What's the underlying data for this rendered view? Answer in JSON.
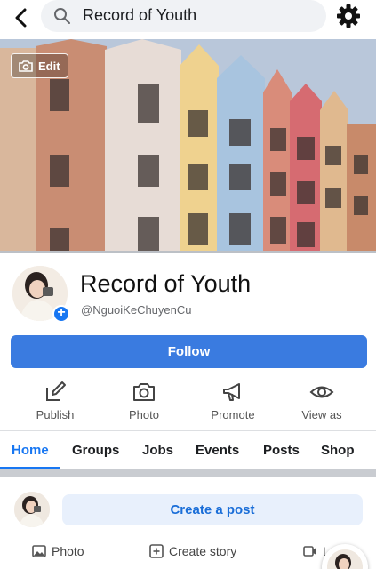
{
  "topbar": {
    "back_icon": "chevron-left-icon",
    "search_icon": "search-icon",
    "search_text": "Record of Youth",
    "settings_icon": "gear-icon"
  },
  "cover": {
    "edit_label": "Edit",
    "edit_icon": "camera-icon"
  },
  "profile": {
    "name": "Record of Youth",
    "handle": "@NguoiKeChuyenCu",
    "add_icon": "plus-icon",
    "accent_color": "#1877f2"
  },
  "follow": {
    "label": "Follow",
    "color": "#3a7be0"
  },
  "actions": [
    {
      "label": "Publish",
      "icon": "edit-icon"
    },
    {
      "label": "Photo",
      "icon": "camera-icon"
    },
    {
      "label": "Promote",
      "icon": "megaphone-icon"
    },
    {
      "label": "View as",
      "icon": "eye-icon"
    }
  ],
  "tabs": [
    {
      "label": "Home",
      "active": true
    },
    {
      "label": "Groups",
      "active": false
    },
    {
      "label": "Jobs",
      "active": false
    },
    {
      "label": "Events",
      "active": false
    },
    {
      "label": "Posts",
      "active": false
    },
    {
      "label": "Shop",
      "active": false
    }
  ],
  "composer": {
    "create_post": "Create a post",
    "photo": "Photo",
    "create_story": "Create story",
    "live_partial": "L"
  }
}
